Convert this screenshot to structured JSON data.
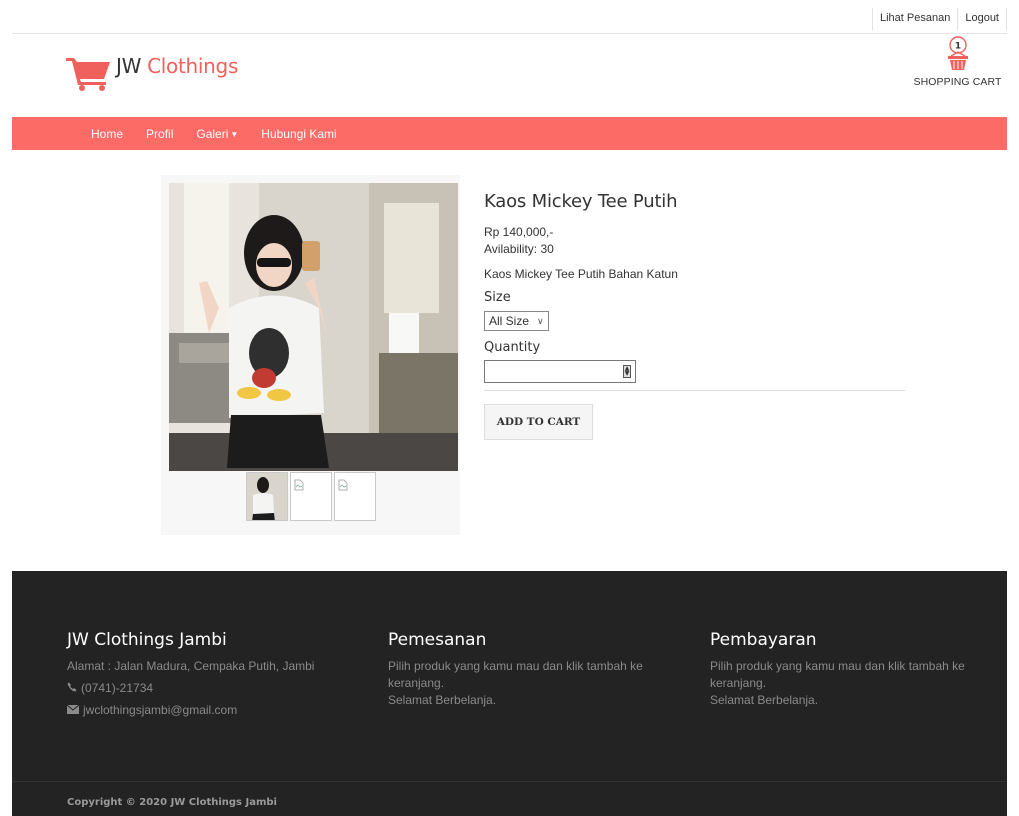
{
  "top_links": {
    "orders": "Lihat Pesanan",
    "logout": "Logout"
  },
  "brand": {
    "part1": "JW",
    "part2": "Clothings",
    "accent_color": "#f0615d"
  },
  "cart": {
    "count": "1",
    "label": "SHOPPING CART"
  },
  "nav": {
    "color": "#fd6b66",
    "items": [
      {
        "label": "Home"
      },
      {
        "label": "Profil"
      },
      {
        "label": "Galeri"
      },
      {
        "label": "Hubungi Kami"
      }
    ]
  },
  "product": {
    "title": "Kaos Mickey Tee Putih",
    "price": "Rp 140,000,-",
    "availability": "Avilability: 30",
    "description": "Kaos Mickey Tee Putih Bahan Katun",
    "size_label": "Size",
    "size_selected": "All Size",
    "quantity_label": "Quantity",
    "quantity_value": "",
    "add_to_cart": "ADD TO CART"
  },
  "footer": {
    "col1": {
      "title": "JW Clothings Jambi",
      "address": "Alamat : Jalan Madura, Cempaka Putih, Jambi",
      "phone": "(0741)-21734",
      "email": "jwclothingsjambi@gmail.com"
    },
    "col2": {
      "title": "Pemesanan",
      "line1": "Pilih produk yang kamu mau dan klik tambah ke",
      "line2": "keranjang.",
      "line3": "Selamat Berbelanja."
    },
    "col3": {
      "title": "Pembayaran",
      "line1": "Pilih produk yang kamu mau dan klik tambah ke",
      "line2": "keranjang.",
      "line3": "Selamat Berbelanja."
    },
    "copyright": "Copyright © 2020 JW Clothings Jambi"
  }
}
